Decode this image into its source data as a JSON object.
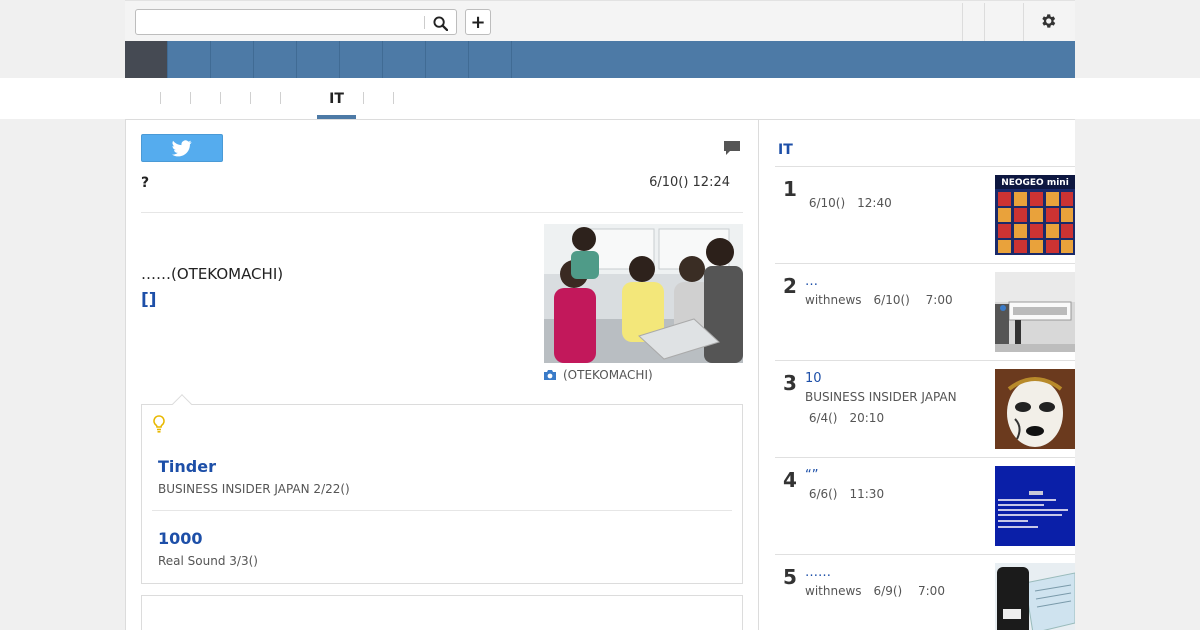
{
  "search": {
    "placeholder": "",
    "value": ""
  },
  "toolbar": {
    "add_label": "+"
  },
  "navbar": {
    "items": [
      "",
      "",
      "",
      "",
      "",
      "",
      "",
      "",
      ""
    ]
  },
  "subnav": {
    "tabs": [
      "",
      "",
      "",
      "",
      "",
      "IT",
      ""
    ],
    "active": "IT"
  },
  "article": {
    "headline": "?",
    "date": "6/10() 12:24",
    "lead_text": "……(OTEKOMACHI)",
    "lead_link": "[]",
    "photo_caption": "(OTEKOMACHI)",
    "related": [
      {
        "title": "Tinder",
        "meta": "BUSINESS INSIDER JAPAN 2/22()"
      },
      {
        "title": "1000",
        "meta": "Real Sound 3/3()"
      }
    ]
  },
  "sidebar": {
    "title": "IT",
    "ranking": [
      {
        "rank": "1",
        "title": "",
        "source": "",
        "date_line": " 6/10()　12:40",
        "thumb": "neogeo-thumbnail"
      },
      {
        "rank": "2",
        "title": "…",
        "source": "",
        "date_line": "withnews　6/10()　 7:00",
        "thumb": "machine-thumbnail"
      },
      {
        "rank": "3",
        "title": "10",
        "source": "BUSINESS INSIDER JAPAN",
        "date_line": " 6/4()　20:10",
        "thumb": "mask-thumbnail"
      },
      {
        "rank": "4",
        "title": "“”",
        "source": "",
        "date_line": " 6/6()　11:30",
        "thumb": "bluescreen-thumbnail"
      },
      {
        "rank": "5",
        "title": "……",
        "source": "",
        "date_line": "withnews　6/9()　 7:00",
        "thumb": "card-reader-thumbnail"
      }
    ]
  },
  "colors": {
    "nav": "#4d7aa6",
    "nav_active": "#454a53",
    "link": "#1d4fa8",
    "twitter": "#55acee",
    "bulb": "#e8b800"
  }
}
